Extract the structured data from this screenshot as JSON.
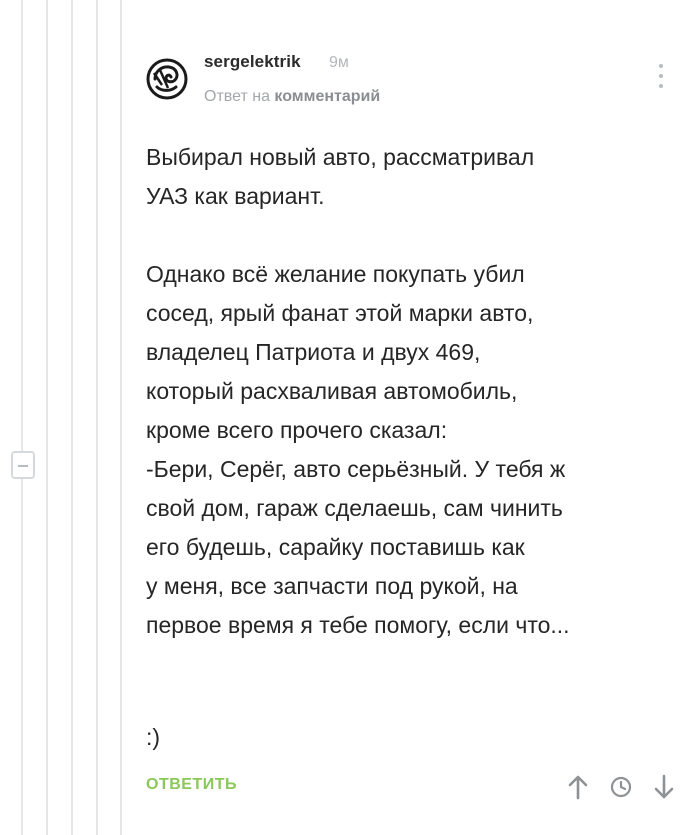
{
  "comment": {
    "author": "sergelektrik",
    "time": "9м",
    "reply_prefix": "Ответ на",
    "reply_target": "комментарий",
    "body_lines": [
      "Выбирал новый авто, рассматривал",
      "УАЗ как вариант.",
      "",
      "Однако всё желание покупать убил",
      "сосед, ярый фанат этой марки авто,",
      "владелец Патриота и двух 469,",
      "который расхваливая автомобиль,",
      "кроме всего прочего сказал:",
      "-Бери, Серёг, авто серьёзный. У тебя ж",
      "свой дом, гараж сделаешь, сам чинить",
      "его будешь, сарайку поставишь как",
      "у меня, все запчасти под рукой, на",
      "первое время я тебе помогу, если что..."
    ],
    "smile": ":)",
    "reply_button": "ОТВЕТИТЬ"
  },
  "colors": {
    "accent": "#8ac858",
    "text": "#262626",
    "muted": "#a3a7ab",
    "thread_line": "#e4e6e8"
  },
  "icons": {
    "avatar": "avatar-spiral-logo",
    "more": "vertical-dots-icon",
    "up": "arrow-up-icon",
    "clock": "clock-icon",
    "down": "arrow-down-icon",
    "collapse": "minus-icon"
  }
}
